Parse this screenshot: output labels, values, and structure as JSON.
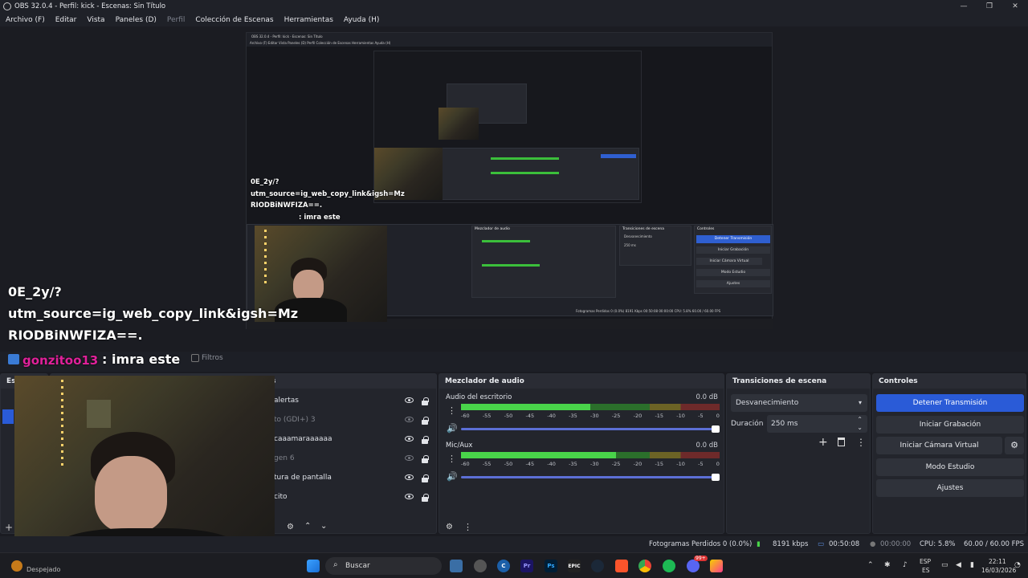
{
  "window": {
    "title": "OBS 32.0.4 - Perfil: kick - Escenas: Sin Título",
    "controls": [
      "—",
      "❐",
      "✕"
    ]
  },
  "menu": [
    "Archivo (F)",
    "Editar",
    "Vista",
    "Paneles (D)",
    "Perfil",
    "Colección de Escenas",
    "Herramientas",
    "Ayuda (H)"
  ],
  "preview": {
    "overlay_lines": [
      "0E_2y/?",
      "utm_source=ig_web_copy_link&igsh=Mz",
      "RIODBiNWFIZA==."
    ],
    "chat_user": "gonzitoo13",
    "chat_message": ": imra este",
    "filters_label": "Filtros",
    "nested_title": "OBS 32.0.4 - Perfil: kick - Escenas: Sin Título",
    "nested_menu": "Archivo (F)   Editar   Vista   Paneles (D)   Perfil   Colección de Escenas   Herramientas   Ayuda (H)",
    "nested_overlay_lines": [
      "0E_2y/?",
      "utm_source=ig_web_copy_link&igsh=Mz",
      "RIODBiNWFIZA==."
    ],
    "nested_chat_message": ": imra este",
    "nested_docks": {
      "mixer": "Mezclador de audio",
      "transitions": "Transiciones de escena",
      "controls": "Controles",
      "stream": "Detener Transmisión",
      "record": "Iniciar Grabación",
      "virtualcam": "Iniciar Cámara Virtual",
      "studio": "Modo Estudio",
      "settings": "Ajustes",
      "fade": "Desvanecimiento",
      "duration_label": "Duración",
      "duration": "250 ms",
      "status": "Fotogramas Perdidos 0 (0.0%)    8191 Kbps        00:50:08        00:00:00    CPU: 5.8%    60.00 / 60.00 FPS"
    }
  },
  "scenes_dock": {
    "title_partial": "Esc"
  },
  "sources": {
    "title_partial": "s",
    "items": [
      {
        "label": "alertas",
        "visible": true
      },
      {
        "label": "to (GDI+) 3",
        "visible": false
      },
      {
        "label": "caaamaraaaaaa",
        "visible": true
      },
      {
        "label": "gen 6",
        "visible": false
      },
      {
        "label": "tura de pantalla",
        "visible": true
      },
      {
        "label": "cito",
        "visible": true
      }
    ]
  },
  "mixer": {
    "title": "Mezclador de audio",
    "channels": [
      {
        "name": "Audio del escritorio",
        "db": "0.0 dB",
        "level": 0.5,
        "volume": 1.0
      },
      {
        "name": "Mic/Aux",
        "db": "0.0 dB",
        "level": 0.6,
        "volume": 1.0
      }
    ],
    "scale": [
      "-60",
      "-55",
      "-50",
      "-45",
      "-40",
      "-35",
      "-30",
      "-25",
      "-20",
      "-15",
      "-10",
      "-5",
      "0"
    ]
  },
  "transitions": {
    "title": "Transiciones de escena",
    "selected": "Desvanecimiento",
    "duration_label": "Duración",
    "duration_value": "250 ms"
  },
  "controls": {
    "title": "Controles",
    "stop_stream": "Detener Transmisión",
    "start_record": "Iniciar Grabación",
    "start_virtualcam": "Iniciar Cámara Virtual",
    "studio_mode": "Modo Estudio",
    "settings": "Ajustes"
  },
  "status": {
    "dropped_frames": "Fotogramas Perdidos 0 (0.0%)",
    "bitrate": "8191 kbps",
    "stream_time": "00:50:08",
    "record_time": "00:00:00",
    "cpu": "CPU: 5.8%",
    "fps": "60.00 / 60.00 FPS"
  },
  "taskbar": {
    "weather": "Despejado",
    "search": "Buscar",
    "language": "ESP",
    "language_sub": "ES",
    "time": "22:11",
    "date": "16/03/2026",
    "discord_badge": "99+"
  },
  "colors": {
    "accent_blue": "#2a5bd7",
    "meter_green": "#49d44a",
    "panel_bg": "#23252c"
  }
}
